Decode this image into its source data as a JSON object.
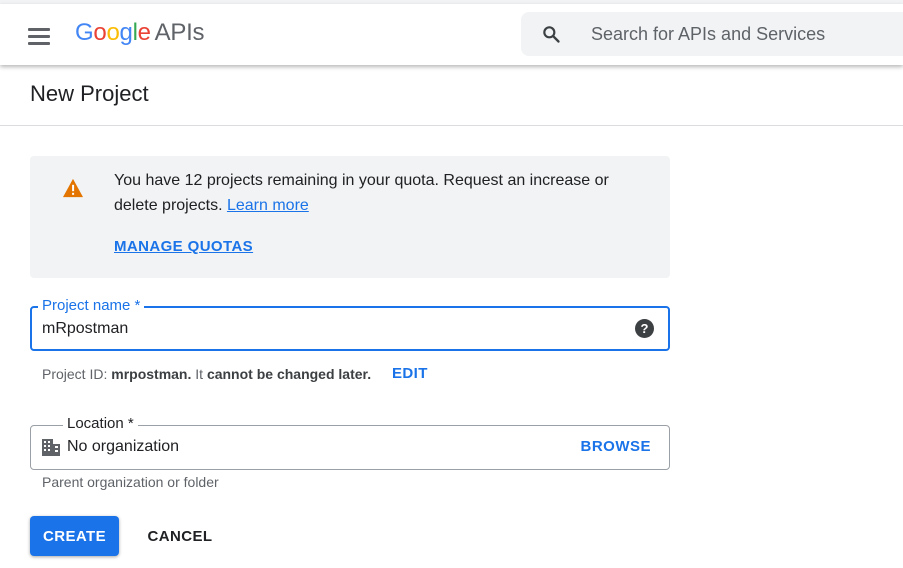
{
  "header": {
    "logo_letters": [
      {
        "char": "G",
        "color": "#4285F4"
      },
      {
        "char": "o",
        "color": "#EA4335"
      },
      {
        "char": "o",
        "color": "#FBBC05"
      },
      {
        "char": "g",
        "color": "#4285F4"
      },
      {
        "char": "l",
        "color": "#34A853"
      },
      {
        "char": "e",
        "color": "#EA4335"
      }
    ],
    "logo_suffix": "APIs",
    "search_placeholder": "Search for APIs and Services",
    "menu_icon": "hamburger-menu-icon",
    "search_icon": "search-icon"
  },
  "page": {
    "title": "New Project"
  },
  "quota_notice": {
    "icon": "warning-icon",
    "icon_color": "#E37400",
    "text": "You have 12 projects remaining in your quota. Request an increase or delete projects.",
    "learn_more": "Learn more",
    "manage_quotas": "MANAGE QUOTAS"
  },
  "project_name": {
    "label": "Project name *",
    "value": "mRpostman",
    "help_icon": "help-icon"
  },
  "project_id": {
    "prefix": "Project ID:",
    "id": "mrpostman.",
    "middle": "It",
    "bold_text": "cannot be changed later.",
    "edit_label": "EDIT"
  },
  "location": {
    "label": "Location *",
    "icon": "building-icon",
    "value": "No organization",
    "browse_label": "BROWSE",
    "hint": "Parent organization or folder"
  },
  "actions": {
    "create_label": "CREATE",
    "cancel_label": "CANCEL"
  },
  "colors": {
    "accent": "#1A73E8",
    "notice_bg": "#F1F3F4"
  }
}
